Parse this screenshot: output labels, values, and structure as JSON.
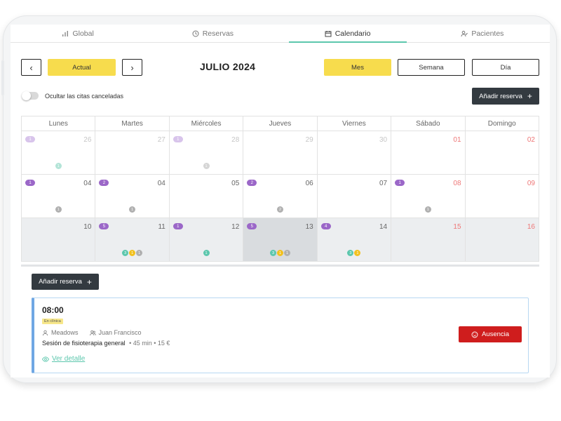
{
  "tabs": [
    {
      "label": "Global",
      "icon": "bar-chart-icon"
    },
    {
      "label": "Reservas",
      "icon": "clock-icon"
    },
    {
      "label": "Calendario",
      "icon": "calendar-icon",
      "active": true
    },
    {
      "label": "Pacientes",
      "icon": "user-check-icon"
    }
  ],
  "toolbar": {
    "prev": "‹",
    "today": "Actual",
    "next": "›",
    "month_title": "JULIO 2024",
    "views": {
      "month": "Mes",
      "week": "Semana",
      "day": "Día"
    },
    "active_view": "Mes",
    "hide_cancelled": "Ocultar las citas canceladas",
    "hide_cancelled_on": false,
    "add": "Añadir reserva",
    "add_icon": "+"
  },
  "calendar": {
    "weekdays": [
      "Lunes",
      "Martes",
      "Miércoles",
      "Jueves",
      "Viernes",
      "Sábado",
      "Domingo"
    ],
    "weeks": [
      [
        {
          "num": "26",
          "faded": true,
          "badge": "1",
          "dots": [
            {
              "c": "teal",
              "t": "1"
            }
          ]
        },
        {
          "num": "27",
          "faded": true
        },
        {
          "num": "28",
          "faded": true,
          "badge": "1",
          "dots": [
            {
              "c": "grey",
              "t": "1"
            }
          ]
        },
        {
          "num": "29",
          "faded": true
        },
        {
          "num": "30",
          "faded": true
        },
        {
          "num": "01",
          "weekend": true
        },
        {
          "num": "02",
          "weekend": true
        }
      ],
      [
        {
          "num": "04",
          "badge": "1",
          "dots": [
            {
              "c": "grey",
              "t": "1"
            }
          ]
        },
        {
          "num": "04",
          "badge": "2",
          "dots": [
            {
              "c": "grey",
              "t": "1"
            }
          ]
        },
        {
          "num": "05"
        },
        {
          "num": "06",
          "badge": "2",
          "dots": [
            {
              "c": "grey",
              "t": "2"
            }
          ]
        },
        {
          "num": "07"
        },
        {
          "num": "08",
          "weekend": true,
          "badge": "1",
          "dots": [
            {
              "c": "grey",
              "t": "1"
            }
          ]
        },
        {
          "num": "09",
          "weekend": true
        }
      ],
      [
        {
          "num": "10",
          "grey": true
        },
        {
          "num": "11",
          "grey": true,
          "badge": "5",
          "dots": [
            {
              "c": "teal",
              "t": "3"
            },
            {
              "c": "yellow",
              "t": "1"
            },
            {
              "c": "grey",
              "t": "1"
            }
          ]
        },
        {
          "num": "12",
          "grey": true,
          "badge": "1",
          "dots": [
            {
              "c": "teal",
              "t": "1"
            }
          ]
        },
        {
          "num": "13",
          "grey": true,
          "selected": true,
          "badge": "5",
          "dots": [
            {
              "c": "teal",
              "t": "3"
            },
            {
              "c": "yellow",
              "t": "1"
            },
            {
              "c": "grey",
              "t": "1"
            }
          ]
        },
        {
          "num": "14",
          "grey": true,
          "badge": "4",
          "dots": [
            {
              "c": "teal",
              "t": "3"
            },
            {
              "c": "yellow",
              "t": "1"
            }
          ]
        },
        {
          "num": "15",
          "grey": true,
          "weekend": true
        },
        {
          "num": "16",
          "grey": true,
          "weekend": true
        }
      ]
    ]
  },
  "panel": {
    "add": "Añadir reserva",
    "add_icon": "+",
    "appointment": {
      "time": "08:00",
      "tag": "En clínica",
      "therapist": "Meadows",
      "patient": "Juan Francisco",
      "session": "Sesión de fisioterapia general",
      "info": "• 45 min • 15 €",
      "detail_link": "Ver detalle",
      "absence_button": "Ausencia"
    }
  },
  "colors": {
    "accent_teal": "#5cc7ad",
    "accent_yellow": "#f7dc4d",
    "dark_button": "#333a40",
    "purple_badge": "#9b67c8",
    "absence_red": "#cf1d1d",
    "card_border": "#6fa7e3"
  }
}
